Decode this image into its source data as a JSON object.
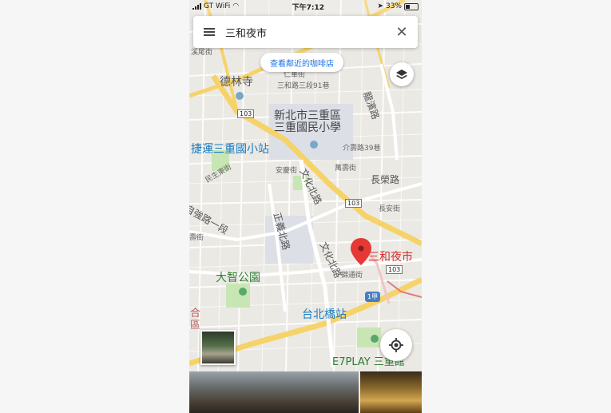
{
  "status_bar": {
    "carrier": "GT WiFi",
    "time": "下午7:12",
    "battery": "33%"
  },
  "search": {
    "query": "三和夜市"
  },
  "suggestion_chip": {
    "label": "查看鄰近的咖啡店"
  },
  "map": {
    "labels": {
      "temple": "德林寺",
      "school": "新北市三重區\n三重國民小學",
      "mrt": "捷運三重國小站",
      "park": "大智公園",
      "taipei_bridge": "台北橋站",
      "pin_label": "三和夜市",
      "e7play": "E7PLAY 三重館",
      "heli": "合",
      "qu": "區",
      "tree": "溪尾街",
      "renhua": "仁華街",
      "sanhe_91": "三和路三段91巷",
      "longmen": "龍濱路",
      "jieshou": "介壽路39巷",
      "anqing": "安慶街",
      "wanshou": "萬壽街",
      "changrong": "長榮路",
      "changan": "長安街",
      "wenhua_n1": "文化北路",
      "wenhua_n2": "文化北路",
      "zhengyi_n": "正義北路",
      "minsheng_e": "民生東街",
      "zizhi1": "自強路一段",
      "shuimen": "壽街",
      "jintong": "錦通街"
    },
    "shields": {
      "route_103": "103",
      "route_1jia": "1甲"
    }
  }
}
